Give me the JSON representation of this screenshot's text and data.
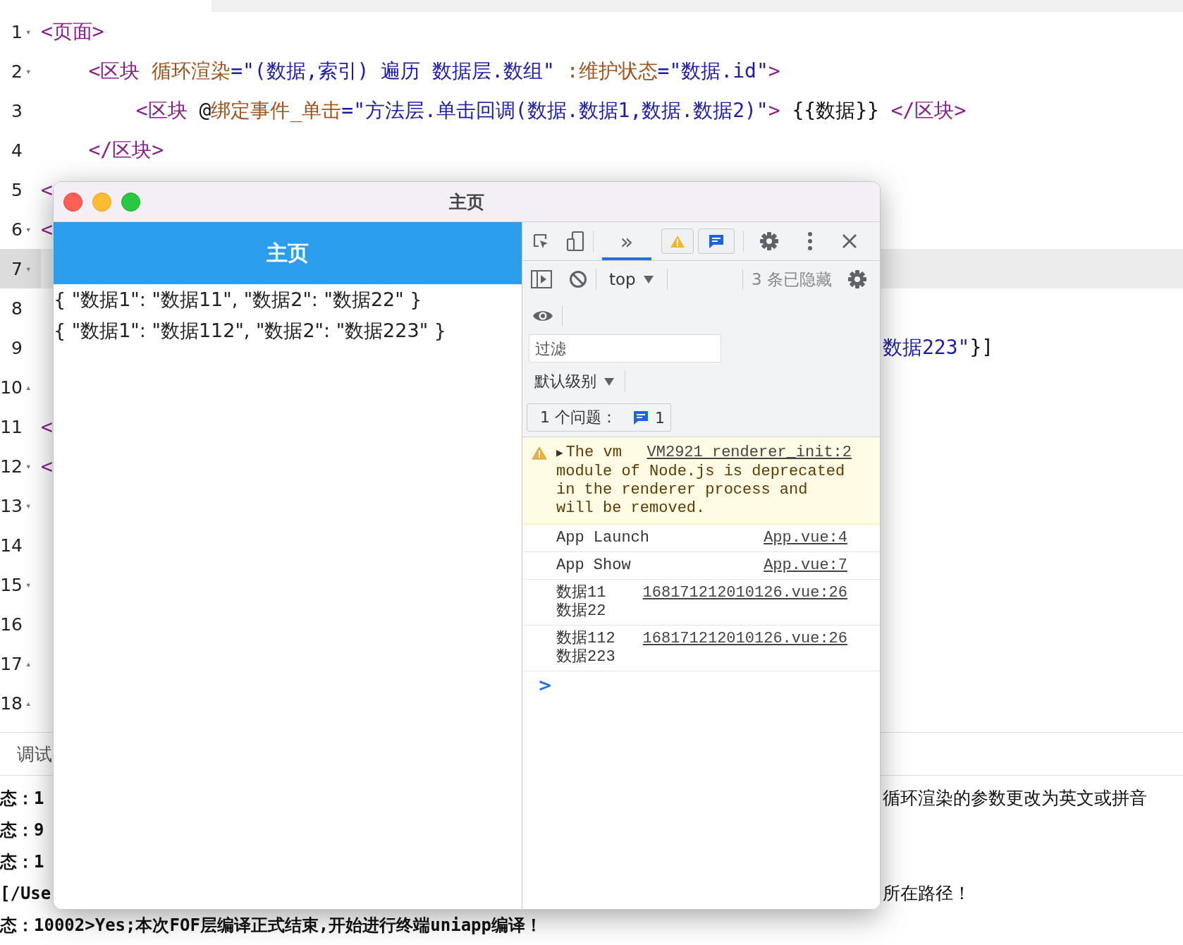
{
  "editor": {
    "lines": [
      {
        "number": "1",
        "fold": "▾",
        "selected": false,
        "tokens": [
          {
            "kind": "tag",
            "text": "<页面>"
          }
        ]
      },
      {
        "number": "2",
        "fold": "▾",
        "selected": false,
        "tokens": [
          {
            "kind": "tag",
            "text": "    <区块 "
          },
          {
            "kind": "attr",
            "text": "循环渲染"
          },
          {
            "kind": "string",
            "text": "=\"(数据,索引) 遍历 数据层.数组\" "
          },
          {
            "kind": "attr",
            "text": ":维护状态"
          },
          {
            "kind": "string",
            "text": "=\"数据.id\""
          },
          {
            "kind": "tag",
            "text": ">"
          }
        ]
      },
      {
        "number": "3",
        "selected": false,
        "tokens": [
          {
            "kind": "tag",
            "text": "        <区块 "
          },
          {
            "kind": "plain",
            "text": "@"
          },
          {
            "kind": "attr",
            "text": "绑定事件_单击"
          },
          {
            "kind": "string",
            "text": "=\"方法层.单击回调(数据.数据1,数据.数据2)\""
          },
          {
            "kind": "tag",
            "text": ">"
          },
          {
            "kind": "plain",
            "text": " {{数据}} "
          },
          {
            "kind": "tag",
            "text": "</区块>"
          }
        ]
      },
      {
        "number": "4",
        "selected": false,
        "tokens": [
          {
            "kind": "tag",
            "text": "    </区块>"
          }
        ]
      },
      {
        "number": "5",
        "selected": false,
        "tokens": [
          {
            "kind": "tag",
            "text": "<"
          }
        ]
      },
      {
        "number": "6",
        "fold": "▾",
        "selected": false,
        "tokens": [
          {
            "kind": "tag",
            "text": "<"
          }
        ]
      },
      {
        "number": "7",
        "fold": "▾",
        "selected": true
      },
      {
        "number": "8",
        "selected": false
      },
      {
        "number": "9",
        "selected": false,
        "right_tokens": [
          {
            "kind": "string",
            "text": "数据223\""
          },
          {
            "kind": "plain",
            "text": "}]"
          }
        ]
      },
      {
        "number": "10",
        "fold": "▴",
        "selected": false
      },
      {
        "number": "11",
        "selected": false,
        "tokens": [
          {
            "kind": "tag",
            "text": "<"
          }
        ]
      },
      {
        "number": "12",
        "fold": "▾",
        "selected": false,
        "tokens": [
          {
            "kind": "tag",
            "text": "<"
          }
        ]
      },
      {
        "number": "13",
        "fold": "▾",
        "selected": false
      },
      {
        "number": "14",
        "selected": false
      },
      {
        "number": "15",
        "fold": "▾",
        "selected": false
      },
      {
        "number": "16",
        "selected": false
      },
      {
        "number": "17",
        "fold": "▴",
        "selected": false
      },
      {
        "number": "18",
        "fold": "▴",
        "selected": false
      }
    ]
  },
  "debug_panel": {
    "tab": "调试",
    "lines": [
      {
        "text": "态：1",
        "right": "循环渲染的参数更改为英文或拼音"
      },
      {
        "text": "态：9"
      },
      {
        "text": "态：1"
      },
      {
        "text": "[/Use",
        "right": "所在路径！"
      },
      {
        "text": "态：10002>Yes;本次FOF层编译正式结束,开始进行终端uniapp编译！"
      }
    ]
  },
  "window": {
    "title": "主页",
    "page": {
      "header": "主页",
      "items": [
        "{ \"数据1\": \"数据11\", \"数据2\": \"数据22\" }",
        "{ \"数据1\": \"数据112\", \"数据2\": \"数据223\" }"
      ]
    },
    "devtools": {
      "overflow_tab": {
        "label": "»",
        "selected": true
      },
      "context": "top",
      "hidden": "3 条已隐藏",
      "filter": {
        "placeholder": "过滤"
      },
      "level": "默认级别",
      "issues": {
        "label": "1 个问题：",
        "count": "1"
      },
      "messages": [
        {
          "kind": "warning",
          "expander": "▶",
          "text": "The vm",
          "continued": "module of Node.js is deprecated in the renderer process and will be removed.",
          "source": "VM2921 renderer_init:2"
        },
        {
          "kind": "log",
          "text": "App Launch",
          "source": "App.vue:4"
        },
        {
          "kind": "log",
          "text": "App Show",
          "source": "App.vue:7"
        },
        {
          "kind": "log",
          "text": "数据11 数据22",
          "source": "168171212010126.vue:26"
        },
        {
          "kind": "log",
          "text": "数据112 数据223",
          "source": "168171212010126.vue:26"
        }
      ],
      "prompt": ">"
    }
  }
}
